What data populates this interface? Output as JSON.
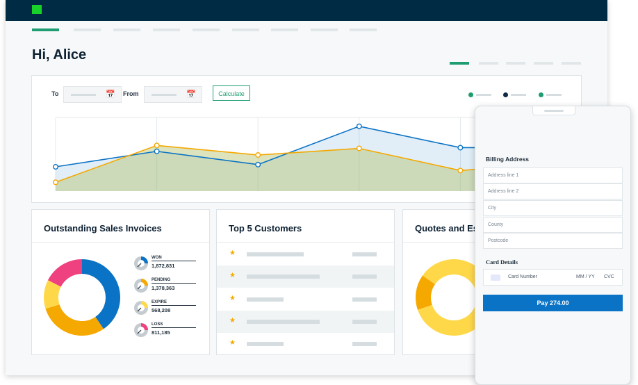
{
  "header": {
    "greeting": "Hi, Alice",
    "brand_color": "#18d129",
    "bar_color": "#002b45",
    "accent": "#1f9d71"
  },
  "filters": {
    "to_label": "To",
    "from_label": "From",
    "calendar_icon": "calendar-icon",
    "calculate_label": "Calculate"
  },
  "legend_colors": [
    "#1f9d71",
    "#0e2a44",
    "#1f9d71"
  ],
  "chart_data": {
    "type": "area",
    "x": [
      0,
      1,
      2,
      3,
      4,
      5
    ],
    "series": [
      {
        "color": "#0b73c5",
        "values": [
          33,
          54,
          36,
          88,
          59,
          59
        ]
      },
      {
        "color": "#f5a800",
        "values": [
          12,
          62,
          49,
          58,
          28,
          38
        ]
      }
    ],
    "ylim": [
      0,
      100
    ],
    "grid": "vertical"
  },
  "invoices": {
    "title": "Outstanding Sales Invoices",
    "donut": [
      {
        "label": "WON",
        "value": 1872831,
        "color": "#0b73c5"
      },
      {
        "label": "PENDING",
        "value": 1378363,
        "color": "#f5a800"
      },
      {
        "label": "EXPIRE",
        "value": 568208,
        "color": "#ffd84a"
      },
      {
        "label": "LOSS",
        "value": 811185,
        "color": "#ef4180"
      }
    ],
    "stats": [
      {
        "name": "WON",
        "value": "1,872,831",
        "color": "#0b73c5"
      },
      {
        "name": "PENDING",
        "value": "1,378,363",
        "color": "#f5a800"
      },
      {
        "name": "EXPIRE",
        "value": "568,208",
        "color": "#ffd84a"
      },
      {
        "name": "LOSS",
        "value": "811,185",
        "color": "#ef4180"
      }
    ]
  },
  "customers": {
    "title": "Top 5 Customers",
    "star_icon": "star-icon"
  },
  "quotes": {
    "title": "Quotes and Es",
    "donut": [
      {
        "label": "",
        "value": 85,
        "color": "#ffd84a"
      },
      {
        "label": "",
        "value": 15,
        "color": "#f5a800"
      }
    ]
  },
  "payment": {
    "billing_title": "Billing Address",
    "fields": [
      "Address line 1",
      "Address line 2",
      "City",
      "County",
      "Postcode"
    ],
    "card_title": "Card Details",
    "card_number": "Card Number",
    "mm_yy": "MM / YY",
    "cvc": "CVC",
    "pay_label": "Pay 274.00"
  }
}
